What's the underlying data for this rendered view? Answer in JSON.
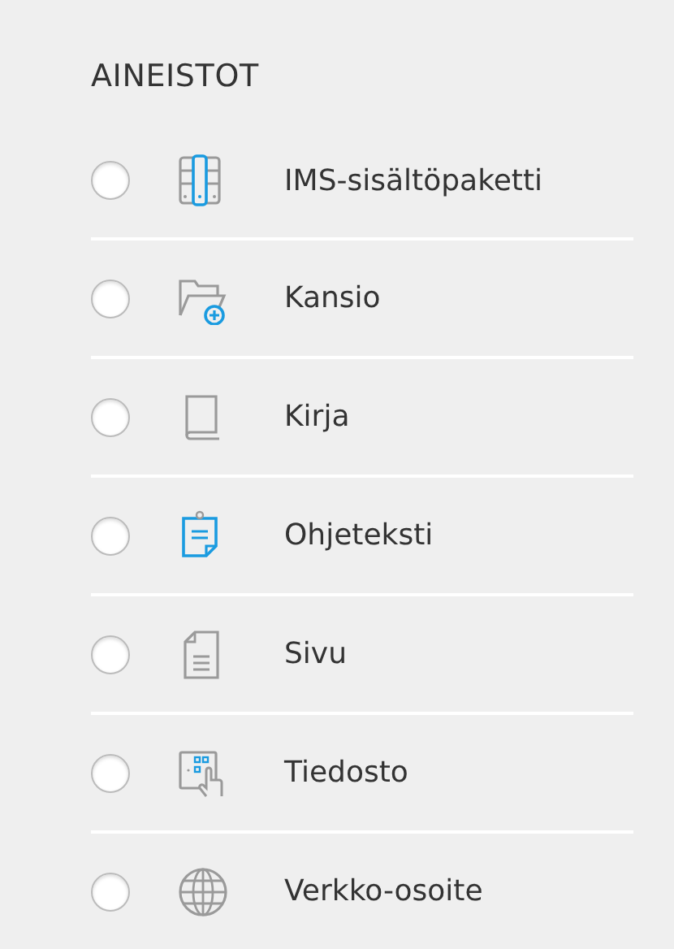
{
  "section": {
    "title": "AINEISTOT",
    "items": [
      {
        "label": "IMS-sisältöpaketti",
        "kind": "package",
        "selected": false
      },
      {
        "label": "Kansio",
        "kind": "folder",
        "selected": false
      },
      {
        "label": "Kirja",
        "kind": "book",
        "selected": false
      },
      {
        "label": "Ohjeteksti",
        "kind": "note",
        "selected": false
      },
      {
        "label": "Sivu",
        "kind": "page",
        "selected": false
      },
      {
        "label": "Tiedosto",
        "kind": "file",
        "selected": false
      },
      {
        "label": "Verkko-osoite",
        "kind": "globe",
        "selected": false
      }
    ]
  }
}
